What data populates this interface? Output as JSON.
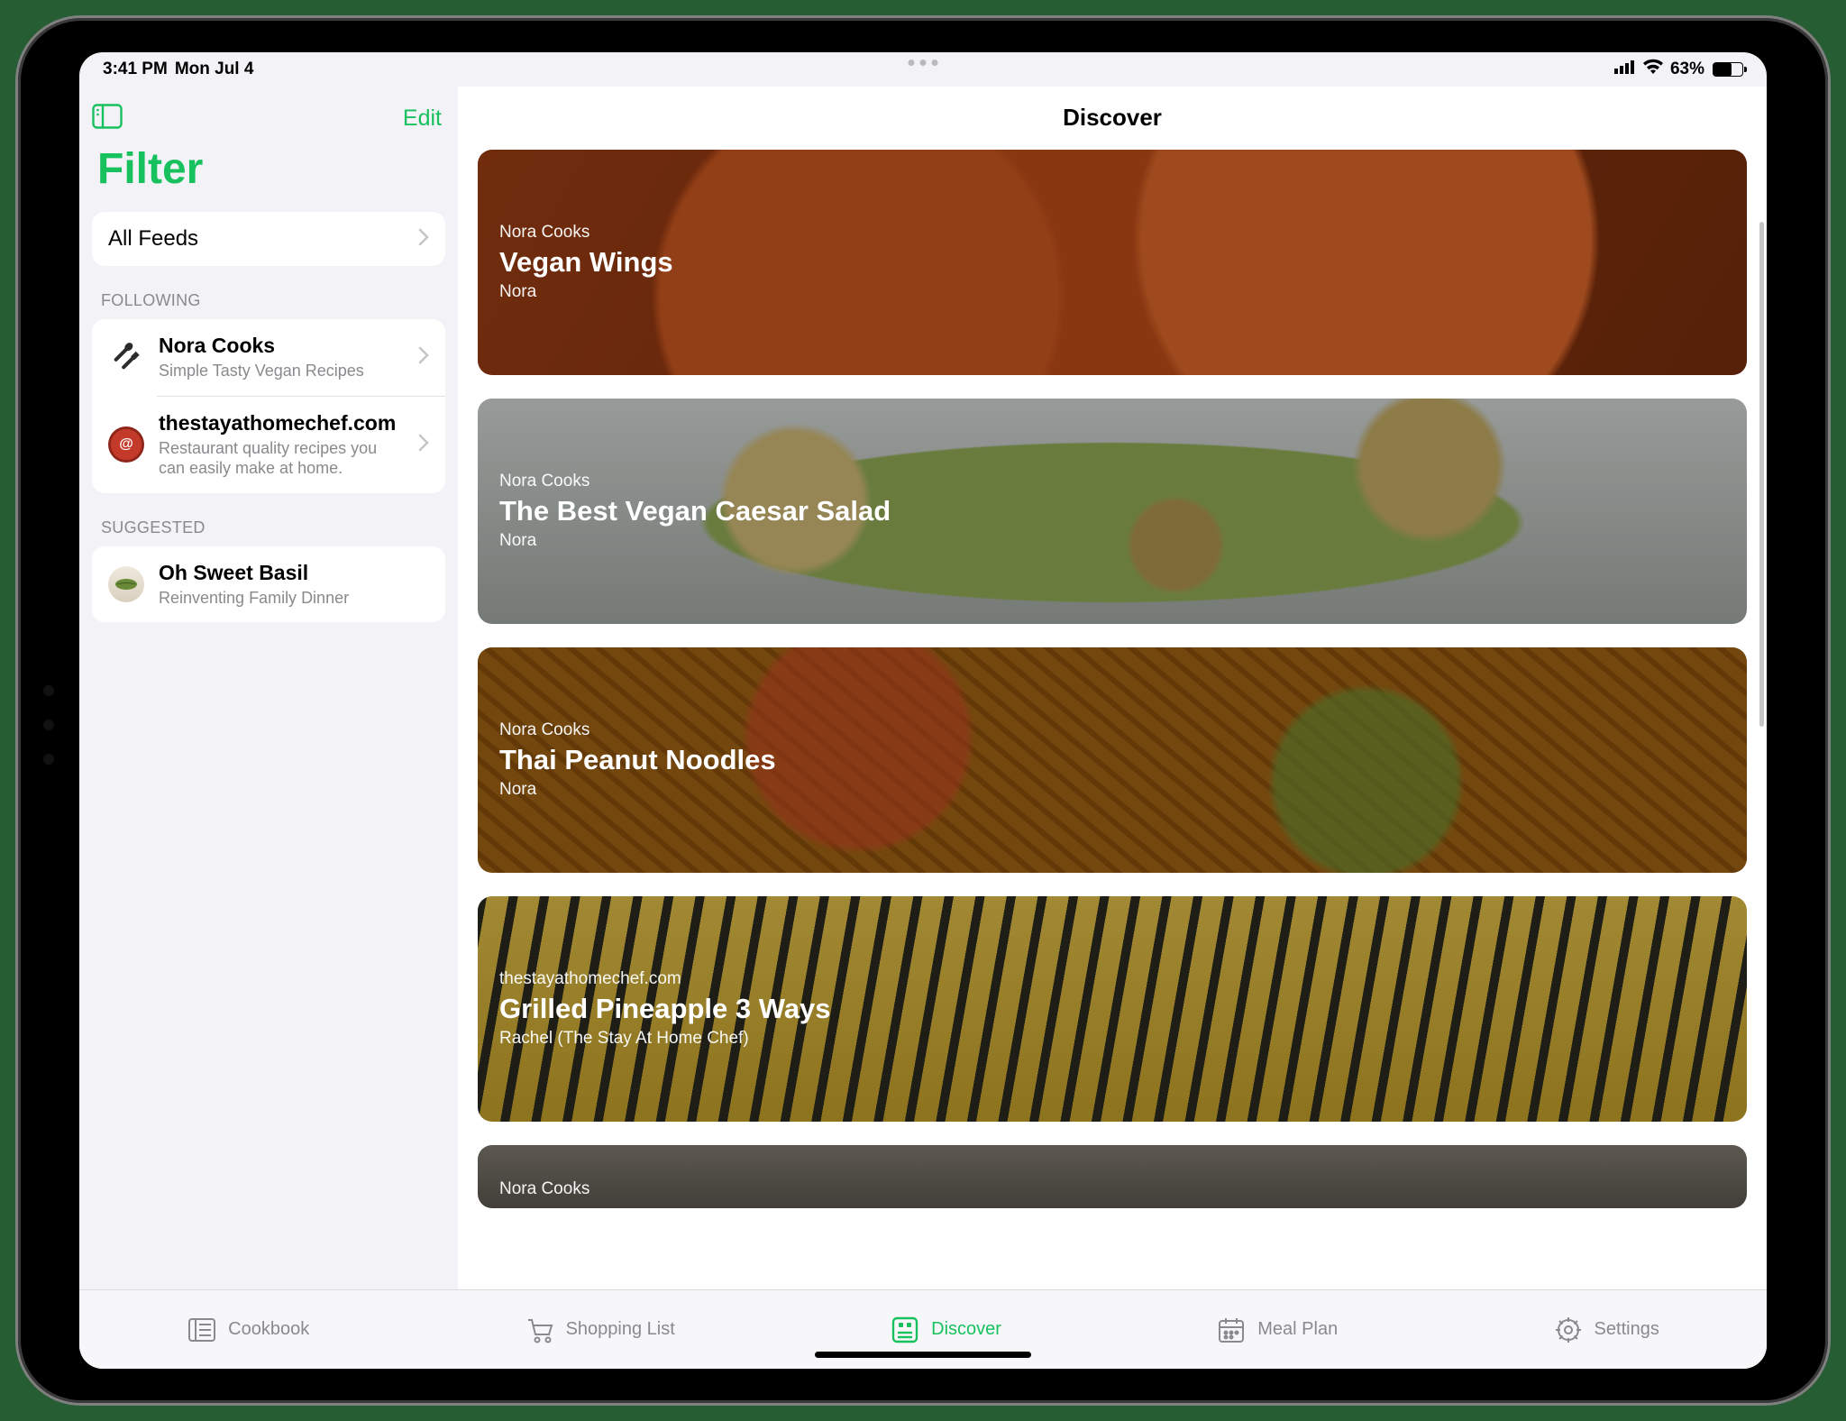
{
  "status": {
    "time": "3:41 PM",
    "date": "Mon Jul 4",
    "battery_pct": "63%",
    "battery_fill": 63
  },
  "sidebar": {
    "edit_label": "Edit",
    "title": "Filter",
    "all_feeds_label": "All Feeds",
    "following_label": "FOLLOWING",
    "suggested_label": "SUGGESTED",
    "following": [
      {
        "name": "Nora Cooks",
        "desc": "Simple Tasty Vegan Recipes",
        "icon": "utensils"
      },
      {
        "name": "thestayathomechef.com",
        "desc": "Restaurant quality recipes you can easily make at home.",
        "icon": "badge"
      }
    ],
    "suggested": [
      {
        "name": "Oh Sweet Basil",
        "desc": "Reinventing Family Dinner",
        "icon": "leaf"
      }
    ]
  },
  "main": {
    "header": "Discover",
    "feed": [
      {
        "source": "Nora Cooks",
        "title": "Vegan Wings",
        "author": "Nora",
        "bg": "bg1"
      },
      {
        "source": "Nora Cooks",
        "title": "The Best Vegan Caesar Salad",
        "author": "Nora",
        "bg": "bg2"
      },
      {
        "source": "Nora Cooks",
        "title": "Thai Peanut Noodles",
        "author": "Nora",
        "bg": "bg3"
      },
      {
        "source": "thestayathomechef.com",
        "title": "Grilled Pineapple 3 Ways",
        "author": "Rachel (The Stay At Home Chef)",
        "bg": "bg4"
      },
      {
        "source": "Nora Cooks",
        "title": "",
        "author": "",
        "bg": "bg5"
      }
    ]
  },
  "tabs": [
    {
      "id": "cookbook",
      "label": "Cookbook",
      "active": false
    },
    {
      "id": "shopping",
      "label": "Shopping List",
      "active": false
    },
    {
      "id": "discover",
      "label": "Discover",
      "active": true
    },
    {
      "id": "mealplan",
      "label": "Meal Plan",
      "active": false
    },
    {
      "id": "settings",
      "label": "Settings",
      "active": false
    }
  ],
  "colors": {
    "accent": "#17c15e"
  }
}
